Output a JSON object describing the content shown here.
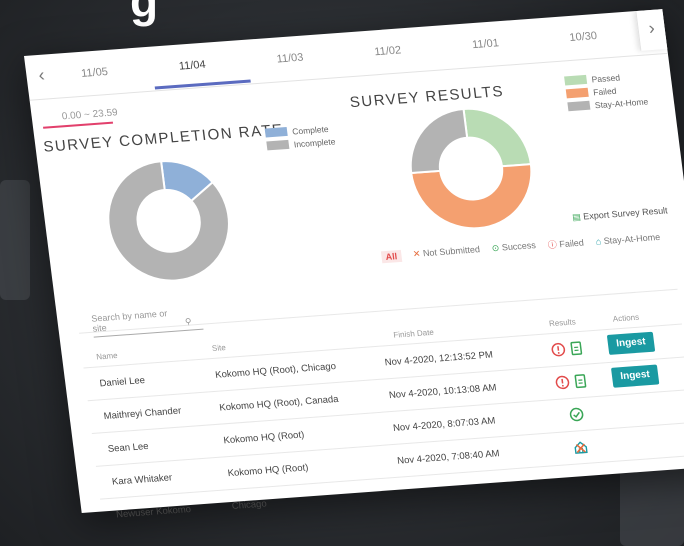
{
  "date_tabs": [
    "11/05",
    "11/04",
    "11/03",
    "11/02",
    "11/01",
    "10/30"
  ],
  "active_tab": "11/04",
  "time_range": "0.00 ~ 23.59",
  "completion": {
    "title": "SURVEY COMPLETION RATE",
    "legend": [
      {
        "label": "Complete",
        "color": "#8fb0d8"
      },
      {
        "label": "Incomplete",
        "color": "#b3b3b3"
      }
    ]
  },
  "results": {
    "title": "SURVEY RESULTS",
    "legend": [
      {
        "label": "Passed",
        "color": "#b9dcb4"
      },
      {
        "label": "Failed",
        "color": "#f4a070"
      },
      {
        "label": "Stay-At-Home",
        "color": "#b3b3b3"
      }
    ]
  },
  "chart_data": [
    {
      "type": "pie",
      "title": "SURVEY COMPLETION RATE",
      "labels": [
        "Complete",
        "Incomplete"
      ],
      "values": [
        15,
        85
      ],
      "colors": [
        "#8fb0d8",
        "#b3b3b3"
      ]
    },
    {
      "type": "pie",
      "title": "SURVEY RESULTS",
      "labels": [
        "Passed",
        "Failed",
        "Stay-At-Home"
      ],
      "values": [
        25,
        50,
        25
      ],
      "colors": [
        "#b9dcb4",
        "#f4a070",
        "#b3b3b3"
      ]
    }
  ],
  "export_label": "Export Survey Result",
  "filters": {
    "all": "All",
    "not_submitted": "Not Submitted",
    "success": "Success",
    "failed": "Failed",
    "stay_at_home": "Stay-At-Home"
  },
  "search_placeholder": "Search by name or site",
  "table": {
    "headers": {
      "name": "Name",
      "site": "Site",
      "finish_date": "Finish Date",
      "results": "Results",
      "actions": "Actions"
    },
    "rows": [
      {
        "name": "Daniel Lee",
        "site": "Kokomo HQ (Root), Chicago",
        "finish_date": "Nov 4-2020, 12:13:52 PM",
        "result": "failed",
        "action": "Ingest"
      },
      {
        "name": "Maithreyi Chander",
        "site": "Kokomo HQ (Root), Canada",
        "finish_date": "Nov 4-2020, 10:13:08 AM",
        "result": "failed",
        "action": "Ingest"
      },
      {
        "name": "Sean Lee",
        "site": "Kokomo HQ (Root)",
        "finish_date": "Nov 4-2020, 8:07:03 AM",
        "result": "success",
        "action": ""
      },
      {
        "name": "Kara Whitaker",
        "site": "Kokomo HQ (Root)",
        "finish_date": "Nov 4-2020, 7:08:40 AM",
        "result": "stay-at-home",
        "action": ""
      },
      {
        "name": "Newuser Kokomo",
        "site": "Chicago",
        "finish_date": "",
        "result": "not-submitted",
        "action": ""
      }
    ]
  }
}
